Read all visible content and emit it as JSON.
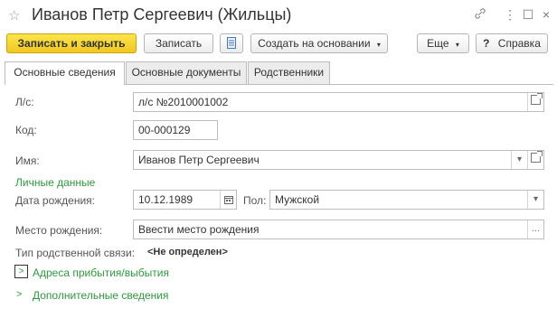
{
  "window": {
    "title": "Иванов Петр Сергеевич (Жильцы)",
    "star_icon": "☆",
    "link_icon": "🔗",
    "more_icon": "⋮",
    "maximize_icon": "☐",
    "close_icon": "×"
  },
  "toolbar": {
    "save_close": "Записать и закрыть",
    "save": "Записать",
    "create_based": "Создать на основании",
    "more": "Еще",
    "help_q": "?",
    "help": "Справка"
  },
  "tabs": [
    {
      "label": "Основные сведения"
    },
    {
      "label": "Основные документы"
    },
    {
      "label": "Родственники"
    }
  ],
  "form": {
    "account_label": "Л/с:",
    "account_value": "л/с №2010001002",
    "code_label": "Код:",
    "code_value": "00-000129",
    "name_label": "Имя:",
    "name_value": "Иванов Петр Сергеевич",
    "personal_section": "Личные данные",
    "birthdate_label": "Дата рождения:",
    "birthdate_value": "10.12.1989",
    "gender_label": "Пол:",
    "gender_value": "Мужской",
    "birthplace_label": "Место рождения:",
    "birthplace_value": "Ввести место рождения",
    "relation_label": "Тип родственной связи:",
    "relation_value": "<Не определен>",
    "addresses_group": "Адреса прибытия/выбытия",
    "extra_group": "Дополнительные сведения"
  },
  "colors": {
    "accent_yellow": "#f5d22a",
    "group_green": "#2e9a3e"
  }
}
